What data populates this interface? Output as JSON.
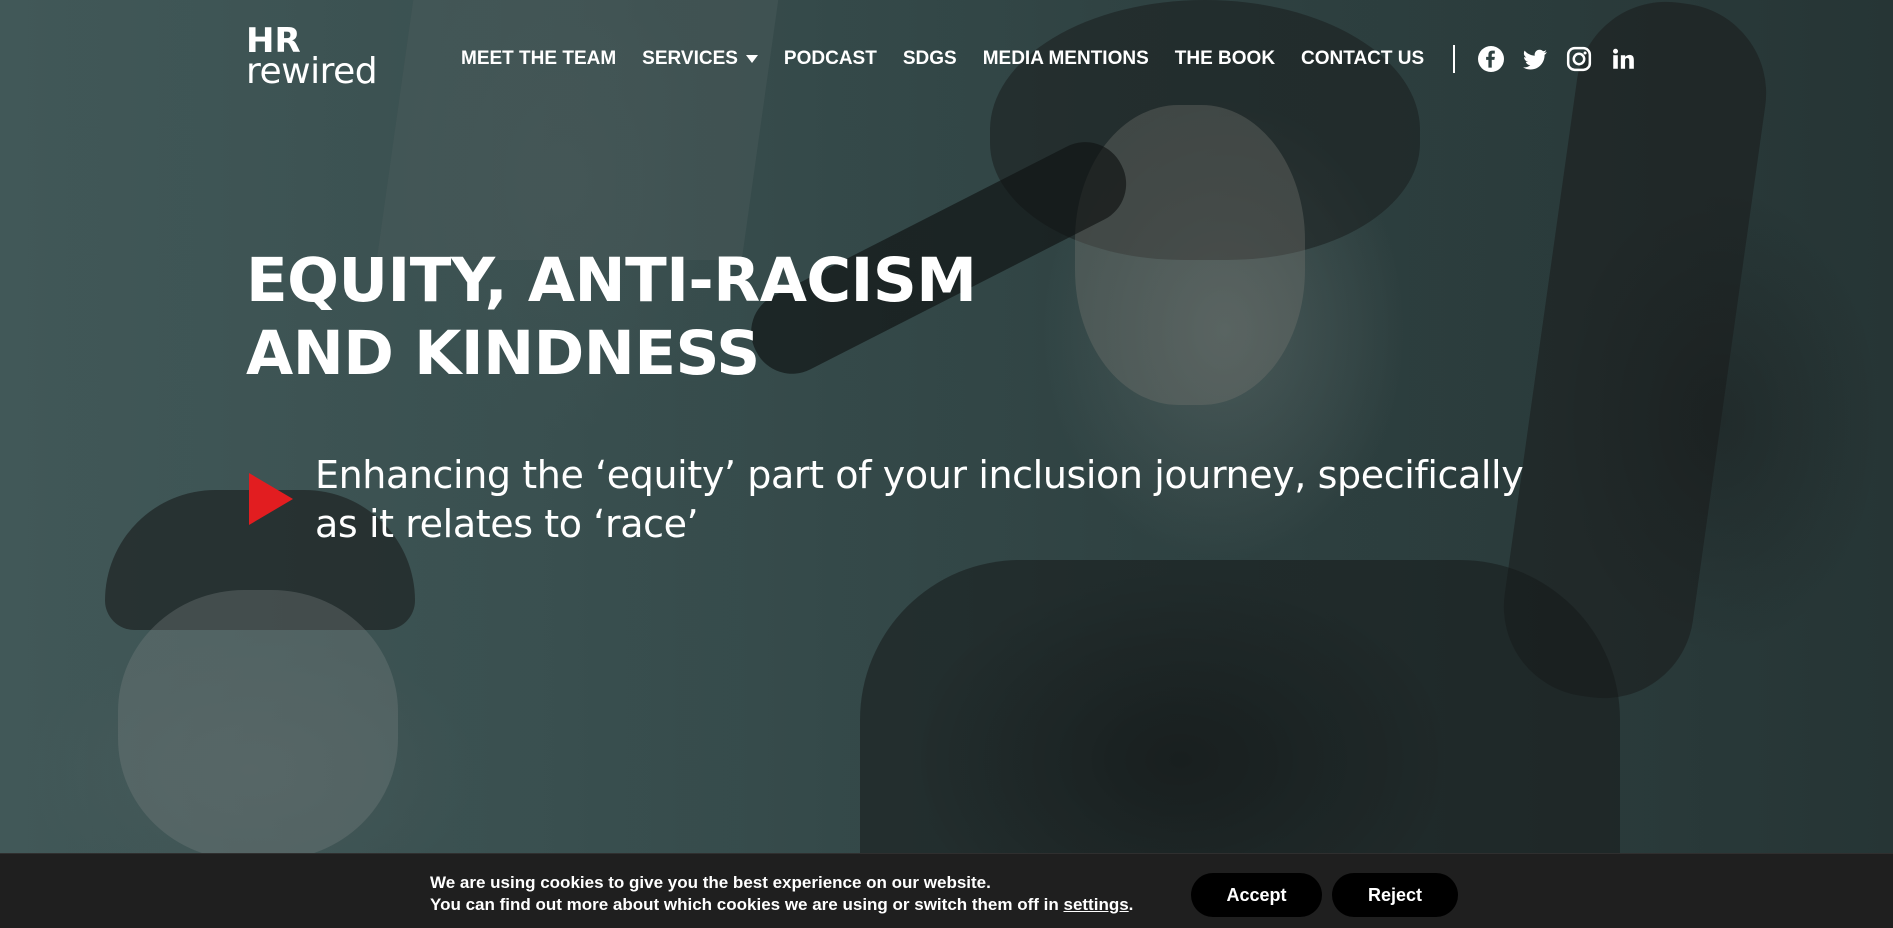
{
  "brand": {
    "line1": "HR",
    "line2": "rewired"
  },
  "navigation": {
    "items": [
      "MEET THE TEAM",
      "SERVICES",
      "PODCAST",
      "SDGS",
      "MEDIA MENTIONS",
      "THE BOOK",
      "CONTACT US"
    ],
    "has_dropdown_item": "SERVICES"
  },
  "social": [
    {
      "name": "facebook",
      "icon": "facebook-icon"
    },
    {
      "name": "twitter",
      "icon": "twitter-icon"
    },
    {
      "name": "instagram",
      "icon": "instagram-icon"
    },
    {
      "name": "linkedin",
      "icon": "linkedin-icon"
    }
  ],
  "hero": {
    "title_lines": [
      "EQUITY, ANTI-RACISM",
      "AND KINDNESS"
    ],
    "subtitle_lines": [
      "Enhancing the ‘equity’ part of your inclusion journey, specifically",
      "as it relates to ‘race’"
    ],
    "marker_icon": "play-triangle-icon",
    "marker_color": "#e21d20"
  },
  "cookie_banner": {
    "line1": "We are using cookies to give you the best experience on our website.",
    "line2_prefix": "You can find out more about which cookies we are using or switch them off in ",
    "line2_link": "settings",
    "line2_suffix": ".",
    "accept": "Accept",
    "reject": "Reject"
  },
  "colors": {
    "overlay": "#3f5656",
    "accent": "#e21d20",
    "cookie_background": "#1f1f1f"
  }
}
